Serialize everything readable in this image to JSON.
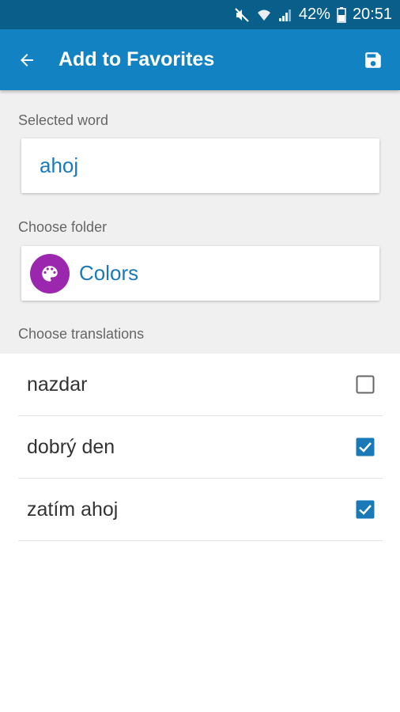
{
  "status_bar": {
    "battery": "42%",
    "time": "20:51",
    "icons": [
      "mute-icon",
      "wifi-icon",
      "signal-icon",
      "battery-icon"
    ]
  },
  "app_bar": {
    "title": "Add to Favorites",
    "back_icon": "arrow-left-icon",
    "save_icon": "save-icon",
    "color": "#1282c2"
  },
  "selected_word": {
    "label": "Selected word",
    "value": "ahoj"
  },
  "folder": {
    "label": "Choose folder",
    "name": "Colors",
    "icon": "palette-icon",
    "icon_color": "#9b27af"
  },
  "translations": {
    "label": "Choose translations",
    "items": [
      {
        "text": "nazdar",
        "checked": false
      },
      {
        "text": "dobrý den",
        "checked": true
      },
      {
        "text": "zatím ahoj",
        "checked": true
      }
    ]
  },
  "colors": {
    "accent": "#1a7ab8",
    "checkbox": "#1a7ab8"
  }
}
